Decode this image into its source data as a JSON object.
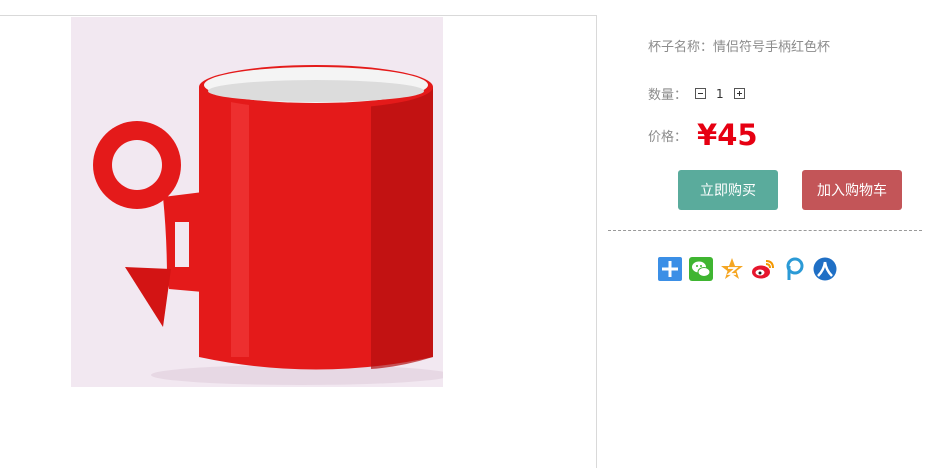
{
  "product": {
    "name_label": "杯子名称：",
    "name_value": "情侣符号手柄红色杯",
    "quantity_label": "数量：",
    "quantity_value": "1",
    "price_label": "价格：",
    "price_value": "¥45"
  },
  "actions": {
    "buy_now_label": "立即购买",
    "add_to_cart_label": "加入购物车"
  },
  "share_icons": [
    "share-more-icon",
    "wechat-icon",
    "qzone-icon",
    "weibo-icon",
    "pengyou-icon",
    "renren-icon"
  ],
  "colors": {
    "price": "#e60012",
    "buy_now": "#5aab9c",
    "add_to_cart": "#c35558"
  }
}
